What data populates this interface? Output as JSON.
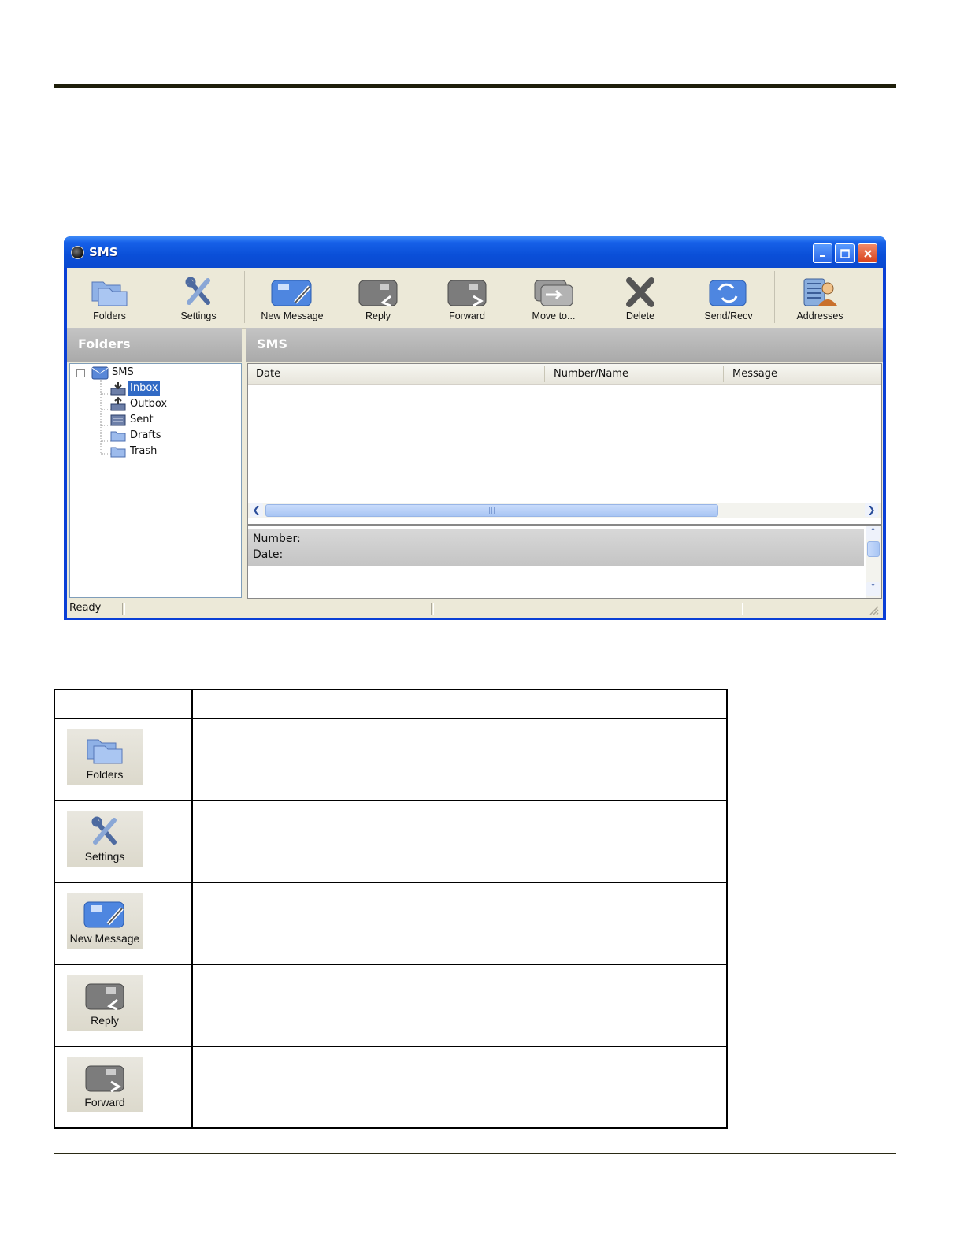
{
  "window": {
    "title": "SMS"
  },
  "toolbar": {
    "buttons": [
      {
        "label": "Folders",
        "icon": "folders-icon"
      },
      {
        "label": "Settings",
        "icon": "settings-icon"
      },
      {
        "label": "New  Message",
        "icon": "new-message-icon"
      },
      {
        "label": "Reply",
        "icon": "reply-icon"
      },
      {
        "label": "Forward",
        "icon": "forward-icon"
      },
      {
        "label": "Move to...",
        "icon": "move-to-icon"
      },
      {
        "label": "Delete",
        "icon": "delete-icon"
      },
      {
        "label": "Send/Recv",
        "icon": "send-recv-icon"
      },
      {
        "label": "Addresses",
        "icon": "addresses-icon"
      }
    ]
  },
  "panes": {
    "folders_header": "Folders",
    "list_header": "SMS"
  },
  "tree": {
    "root": "SMS",
    "items": [
      "Inbox",
      "Outbox",
      "Sent",
      "Drafts",
      "Trash"
    ],
    "selected": "Inbox"
  },
  "list": {
    "columns": [
      "Date",
      "Number/Name",
      "Message"
    ]
  },
  "detail": {
    "number_label": "Number:",
    "date_label": "Date:"
  },
  "status": {
    "text": "Ready"
  },
  "table": {
    "rows": [
      {
        "label": "Folders",
        "icon": "folders-icon"
      },
      {
        "label": "Settings",
        "icon": "settings-icon"
      },
      {
        "label": "New  Message",
        "icon": "new-message-icon"
      },
      {
        "label": "Reply",
        "icon": "reply-icon"
      },
      {
        "label": "Forward",
        "icon": "forward-icon"
      }
    ]
  },
  "colors": {
    "titlebar": "#0a4fd8",
    "selection": "#316ac5",
    "chrome": "#ece9d8"
  }
}
